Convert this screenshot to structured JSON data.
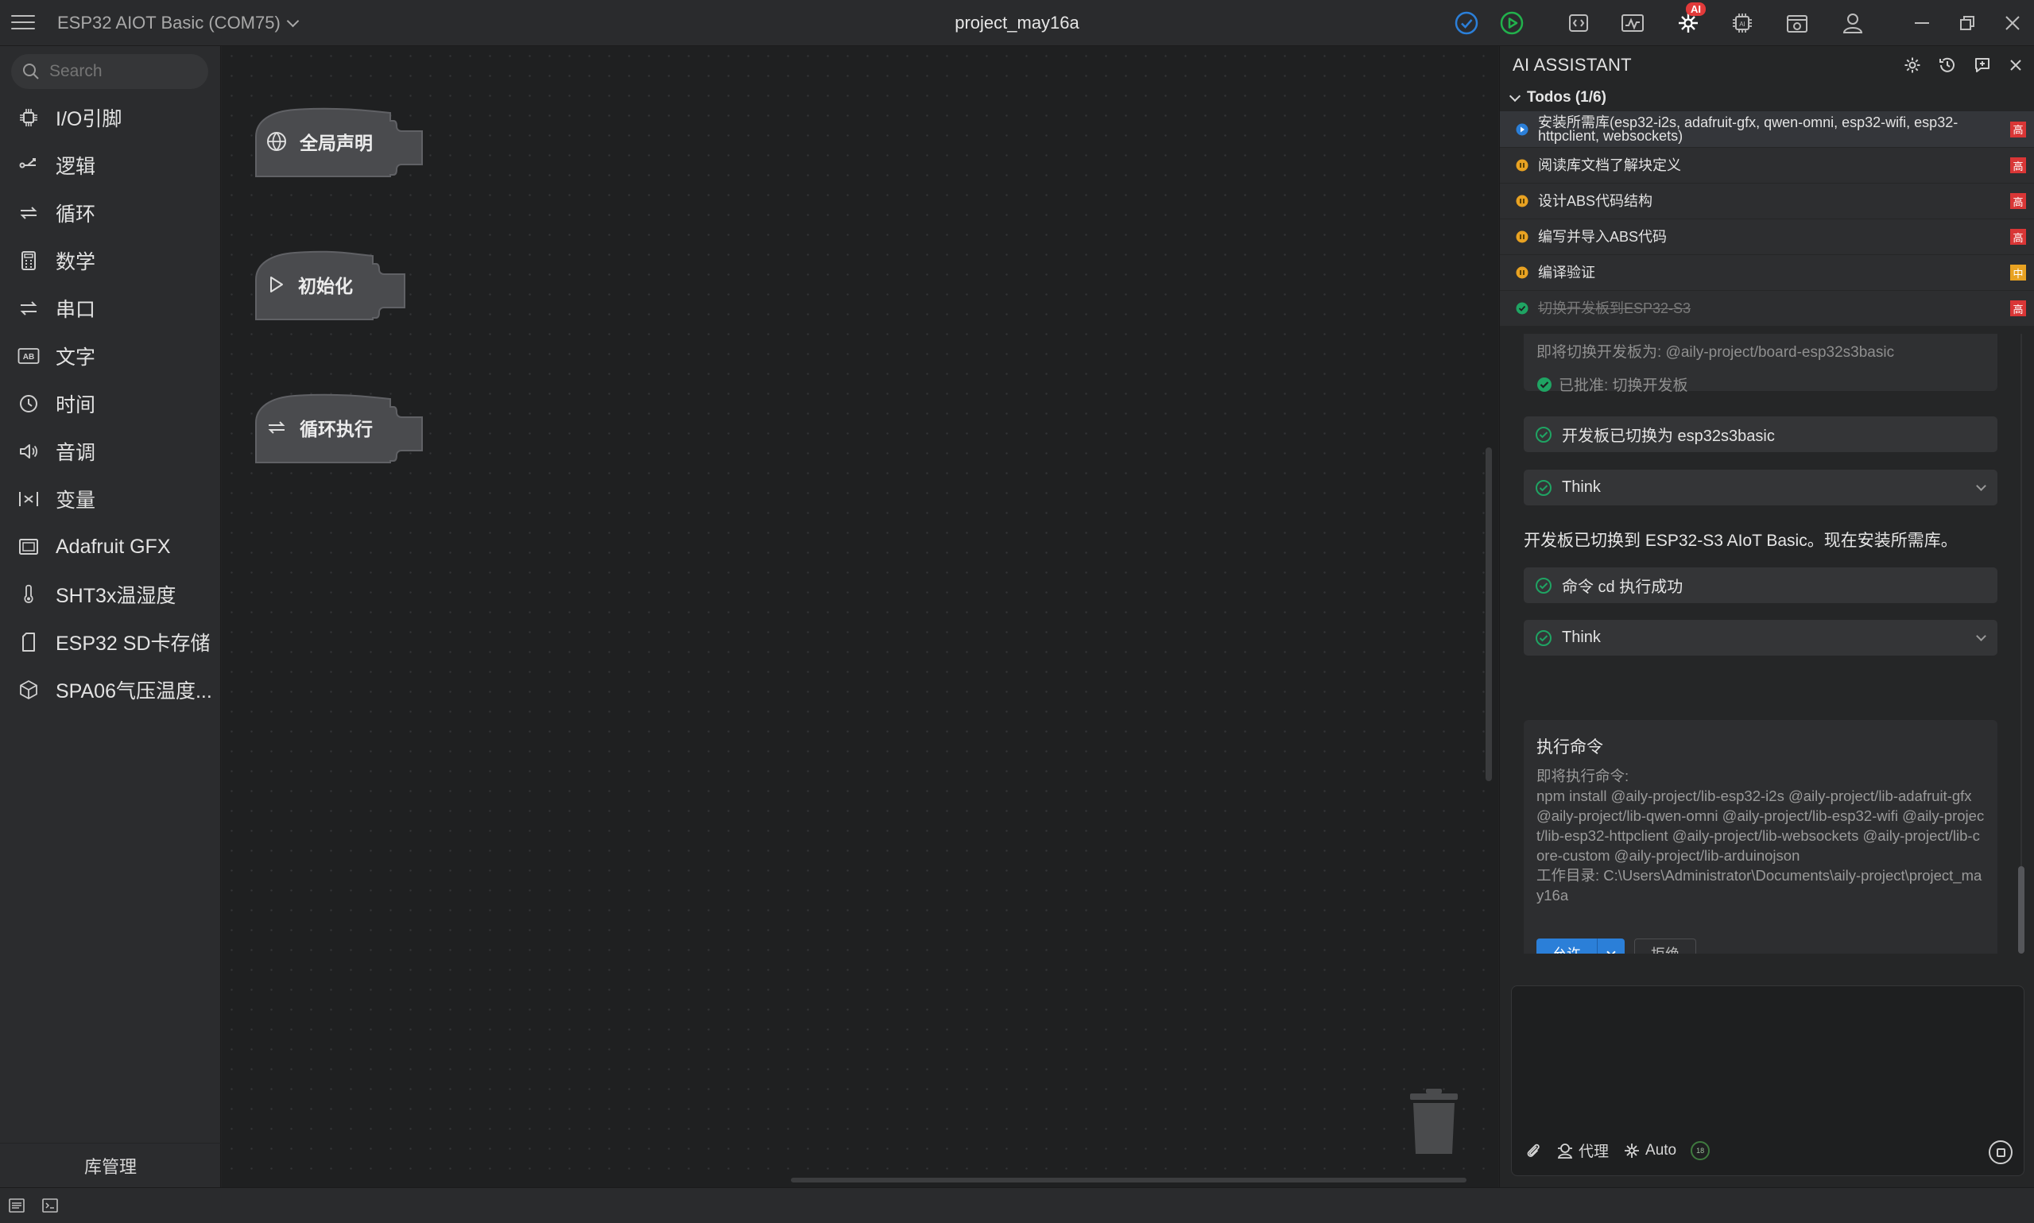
{
  "titlebar": {
    "board": "ESP32 AIOT Basic (COM75)",
    "project_title": "project_may16a",
    "ai_badge": "AI"
  },
  "sidebar": {
    "search_placeholder": "Search",
    "categories": [
      {
        "label": "I/O引脚",
        "icon": "chip-icon"
      },
      {
        "label": "逻辑",
        "icon": "branch-icon"
      },
      {
        "label": "循环",
        "icon": "repeat-icon"
      },
      {
        "label": "数学",
        "icon": "calculator-icon"
      },
      {
        "label": "串口",
        "icon": "swap-icon"
      },
      {
        "label": "文字",
        "icon": "text-ab-icon"
      },
      {
        "label": "时间",
        "icon": "clock-icon"
      },
      {
        "label": "音调",
        "icon": "speaker-icon"
      },
      {
        "label": "变量",
        "icon": "variable-icon"
      },
      {
        "label": "Adafruit GFX",
        "icon": "display-icon"
      },
      {
        "label": "SHT3x温湿度",
        "icon": "thermometer-icon"
      },
      {
        "label": "ESP32 SD卡存储",
        "icon": "sdcard-icon"
      },
      {
        "label": "SPA06气压温度...",
        "icon": "cube-icon"
      }
    ],
    "library_manage": "库管理"
  },
  "workspace": {
    "blocks": [
      {
        "label": "全局声明",
        "icon": "globe-icon"
      },
      {
        "label": "初始化",
        "icon": "play-icon"
      },
      {
        "label": "循环执行",
        "icon": "repeat-icon"
      }
    ]
  },
  "ai_panel": {
    "title": "AI ASSISTANT",
    "todos_header": "Todos (1/6)",
    "todos": [
      {
        "text": "安装所需库(esp32-i2s, adafruit-gfx, qwen-omni, esp32-wifi, esp32-httpclient, websockets)",
        "status": "in-progress",
        "priority": "高"
      },
      {
        "text": "阅读库文档了解块定义",
        "status": "pending",
        "priority": "高"
      },
      {
        "text": "设计ABS代码结构",
        "status": "pending",
        "priority": "高"
      },
      {
        "text": "编写并导入ABS代码",
        "status": "pending",
        "priority": "高"
      },
      {
        "text": "编译验证",
        "status": "pending",
        "priority": "中"
      },
      {
        "text": "切换开发板到ESP32-S3",
        "status": "done",
        "priority": "高"
      }
    ],
    "chat": {
      "switch_board_note": "即将切换开发板为: @aily-project/board-esp32s3basic",
      "approved": "已批准: 切换开发板",
      "board_switched": "开发板已切换为 esp32s3basic",
      "think_1": "Think",
      "assistant_text": "开发板已切换到 ESP32-S3 AIoT Basic。现在安装所需库。",
      "cmd_success": "命令 cd 执行成功",
      "think_2": "Think",
      "exec_title": "执行命令",
      "exec_intro": "即将执行命令:",
      "exec_command": "npm install @aily-project/lib-esp32-i2s @aily-project/lib-adafruit-gfx @aily-project/lib-qwen-omni @aily-project/lib-esp32-wifi @aily-project/lib-esp32-httpclient @aily-project/lib-websockets @aily-project/lib-core-custom @aily-project/lib-arduinojson",
      "exec_cwd": "工作目录: C:\\Users\\Administrator\\Documents\\aily-project\\project_may16a",
      "allow": "允许",
      "reject": "拒绝"
    },
    "input": {
      "placeholder": "",
      "mode_agent": "代理",
      "mode_auto": "Auto",
      "context_count": "18"
    }
  },
  "colors": {
    "accent_blue": "#2b7fd8",
    "priority_high": "#d93636",
    "priority_mid": "#e8a222",
    "pending": "#e8a222",
    "done": "#1fa463"
  }
}
